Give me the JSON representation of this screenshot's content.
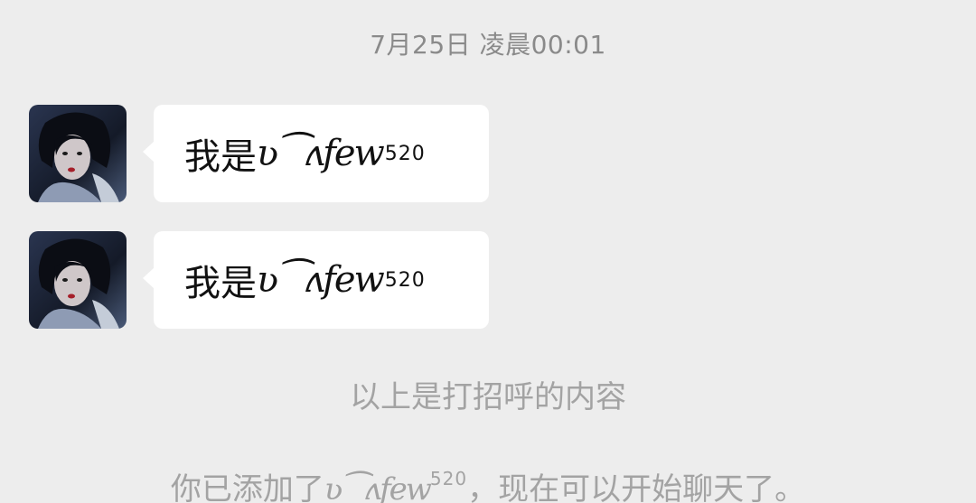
{
  "chat": {
    "timestamp": "7月25日 凌晨00:01",
    "messages": [
      {
        "prefix": "我是",
        "name": "ʋ⁀ʌfew",
        "superscript": "520"
      },
      {
        "prefix": "我是",
        "name": "ʋ⁀ʌfew",
        "superscript": "520"
      }
    ],
    "greeting_note": "以上是打招呼的内容",
    "added_note": {
      "prefix": "你已添加了",
      "name": "ʋ⁀ʌfew",
      "superscript": "520",
      "suffix": "，现在可以开始聊天了。"
    }
  },
  "colors": {
    "background": "#ededed",
    "bubble": "#ffffff",
    "timestamp_text": "#8a8a8a",
    "system_text": "#a3a3a3"
  },
  "icons": {
    "avatar": "profile-photo-avatar"
  }
}
